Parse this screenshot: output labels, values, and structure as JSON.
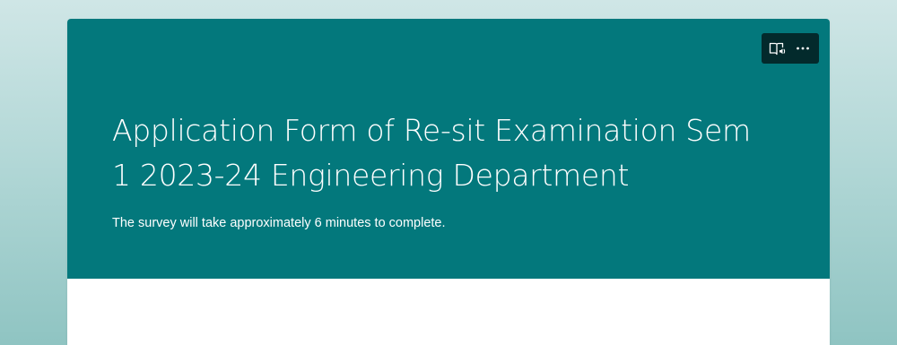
{
  "form": {
    "title": "Application Form of Re-sit Examination Sem 1 2023-24 Engineering Department",
    "subtitle": "The survey will take approximately 6 minutes to complete."
  },
  "toolbar": {
    "buttons": [
      {
        "icon": "immersive-reader-icon"
      },
      {
        "icon": "more-options-icon"
      }
    ]
  },
  "colors": {
    "header": "#03787c",
    "toolbar": "#032a2c",
    "background_top": "#cfe6e6",
    "background_bottom": "#8fc4c2",
    "card": "#ffffff"
  }
}
